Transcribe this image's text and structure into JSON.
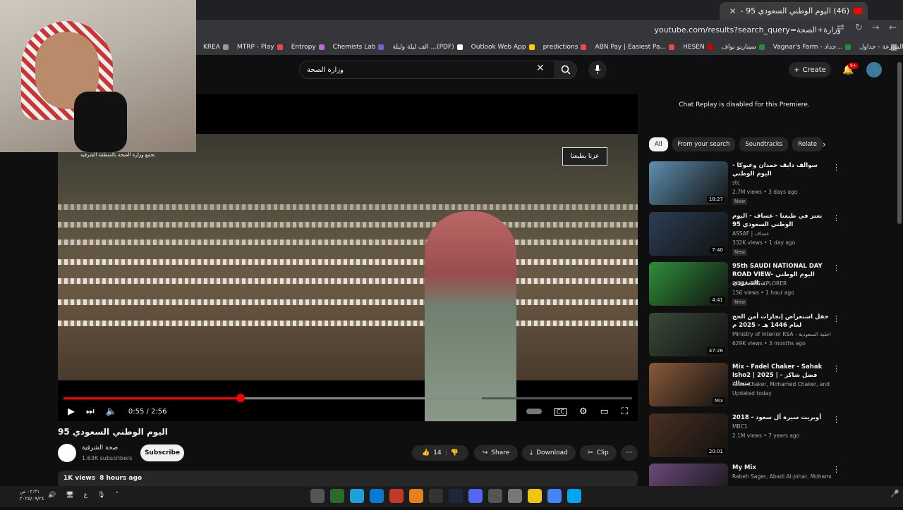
{
  "browser": {
    "tab_title": "(46) اليوم الوطني السعودي 95 -",
    "new_tab": "+",
    "close_tab": "✕",
    "url": "youtube.com/results?search_query=وزارة+الصحة",
    "bookmarks": [
      "KREA",
      "MTRP - Play",
      "Entropy",
      "Chemists Lab",
      "الف ليلة وليلة ...(PDF)",
      "Outlook Web App",
      "predictions",
      "ABN Pay | Easiest Pa...",
      "HESEN",
      "سيناريو نواف",
      "Vagnar's Farm - جداد...",
      "إدارة المزرعة - جداول..."
    ],
    "bookmark_colors": [
      "#999999",
      "#e84a4a",
      "#b86bd6",
      "#7c5cd6",
      "#ffffff",
      "#ffcc00",
      "#e84a4a",
      "#e84a4a",
      "#cc0000",
      "#1e8f3a",
      "#1e8f3a",
      "#1e8f3a"
    ]
  },
  "youtube": {
    "search_query": "وزارة الصحة",
    "create_label": "Create",
    "notif_count": "9+",
    "player": {
      "overlay_logo": "عزنا بطبعنا",
      "overlay_ministry": "تجمع وزارة الصحة بالمنطقة الشرقية",
      "time": "0:55 / 2:56",
      "progress": 0.312
    },
    "video_title": "اليوم الوطني السعودي 95",
    "channel_name": "صحة الشرقية",
    "subscribers": "1.63K subscribers",
    "subscribe_label": "Subscribe",
    "likes": "14",
    "share_label": "Share",
    "download_label": "Download",
    "clip_label": "Clip",
    "views": "1K views",
    "uploaded": "8 hours ago",
    "chat_replay": "Chat Replay is disabled for this Premiere.",
    "chips": [
      "All",
      "From your search",
      "Soundtracks",
      "Relate"
    ],
    "related": [
      {
        "title": "سوالف دايف حمدان وعبوكا - اليوم الوطني",
        "channel": "stc",
        "meta": "2.7M views • 3 days ago",
        "badge": "New",
        "duration": "18:27",
        "color": "#5f8fb0"
      },
      {
        "title": "نعتز في طبعنا - عساف - اليوم الوطني السعودي 95",
        "channel": "ASSAF | عساف",
        "meta": "332K views • 1 day ago",
        "badge": "New",
        "duration": "7:40",
        "color": "#2c3e55"
      },
      {
        "title": "95th SAUDI NATIONAL DAY ROAD VIEW- اليوم الوطني السعودي...",
        "channel": "SIDRA THE XPLORER",
        "meta": "156 views • 1 hour ago",
        "badge": "New",
        "duration": "4:41",
        "color": "#2f8f3a"
      },
      {
        "title": "حفل استعراض إنجازات أمن الحج لعام 1446 هـ - 2025 م",
        "channel": "Ministry of Interior KSA - وزارة الداخلية السعودية",
        "meta": "629K views • 3 months ago",
        "badge": "",
        "duration": "47:26",
        "color": "#3a4a3a"
      },
      {
        "title": "Mix - Fadel Chaker - Sahak Isho2 | 2025 | فضل شاكر - سحاك",
        "channel": "Fadel Chaker, Mohamed Chaker, and more",
        "meta": "Updated today",
        "badge": "",
        "duration": "Mix",
        "color": "#8a5a3a"
      },
      {
        "title": "أوبريت سيرة آل سعود - 2018",
        "channel": "MBC1",
        "meta": "2.1M views • 7 years ago",
        "badge": "",
        "duration": "20:01",
        "color": "#4a3020"
      },
      {
        "title": "My Mix",
        "channel": "Rabeh Sager, Abadi Al-Johar, Mohamme...",
        "meta": "",
        "badge": "",
        "duration": "",
        "color": "#6a4a7a"
      }
    ]
  },
  "taskbar": {
    "time": "٠٢:٣١ ص",
    "date": "٢٠٢٥/٠٩/٢٤",
    "lang": "ع",
    "app_colors": [
      "#555555",
      "#2a6a2a",
      "#1ba0d8",
      "#0a7ad0",
      "#c0392b",
      "#e67e22",
      "#333333",
      "#1b2838",
      "#5865f2",
      "#555555",
      "#777777",
      "#f1c40f",
      "#4285f4",
      "#00a4ef"
    ]
  }
}
